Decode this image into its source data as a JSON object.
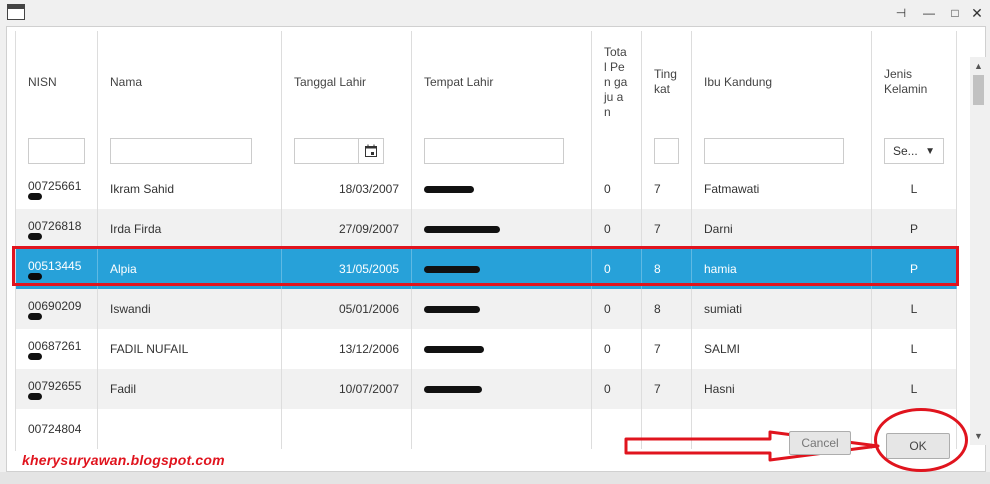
{
  "window": {
    "pin_glyph": "⊣",
    "minimize_glyph": "—",
    "maximize_glyph": "□",
    "close_glyph": "✕"
  },
  "columns": [
    {
      "key": "nisn",
      "label": "NISN"
    },
    {
      "key": "nama",
      "label": "Nama"
    },
    {
      "key": "tanggal_lahir",
      "label": "Tanggal Lahir"
    },
    {
      "key": "tempat_lahir",
      "label": "Tempat Lahir"
    },
    {
      "key": "total_pengajuan",
      "label": "Tota l Pen gaju an"
    },
    {
      "key": "tingkat",
      "label": "Ting kat"
    },
    {
      "key": "ibu_kandung",
      "label": "Ibu Kandung"
    },
    {
      "key": "jenis_kelamin",
      "label": "Jenis Kelamin"
    }
  ],
  "filters": {
    "jenis_kelamin_select": "Se...",
    "dropdown_glyph": "▼",
    "calendar_glyph": "📅"
  },
  "rows": [
    {
      "nisn": "00725661",
      "nama": "Ikram Sahid",
      "tanggal_lahir": "18/03/2007",
      "total_pengajuan": "0",
      "tingkat": "7",
      "ibu_kandung": "Fatmawati",
      "jenis_kelamin": "L",
      "selected": false
    },
    {
      "nisn": "00726818",
      "nama": "Irda Firda",
      "tanggal_lahir": "27/09/2007",
      "total_pengajuan": "0",
      "tingkat": "7",
      "ibu_kandung": "Darni",
      "jenis_kelamin": "P",
      "selected": false
    },
    {
      "nisn": "00513445",
      "nama": "Alpia",
      "tanggal_lahir": "31/05/2005",
      "total_pengajuan": "0",
      "tingkat": "8",
      "ibu_kandung": "hamia",
      "jenis_kelamin": "P",
      "selected": true
    },
    {
      "nisn": "00690209",
      "nama": "Iswandi",
      "tanggal_lahir": "05/01/2006",
      "total_pengajuan": "0",
      "tingkat": "8",
      "ibu_kandung": "sumiati",
      "jenis_kelamin": "L",
      "selected": false
    },
    {
      "nisn": "00687261",
      "nama": "FADIL NUFAIL",
      "tanggal_lahir": "13/12/2006",
      "total_pengajuan": "0",
      "tingkat": "7",
      "ibu_kandung": "SALMI",
      "jenis_kelamin": "L",
      "selected": false
    },
    {
      "nisn": "00792655",
      "nama": "Fadil",
      "tanggal_lahir": "10/07/2007",
      "total_pengajuan": "0",
      "tingkat": "7",
      "ibu_kandung": "Hasni",
      "jenis_kelamin": "L",
      "selected": false
    },
    {
      "nisn": "00724804",
      "nama": "",
      "tanggal_lahir": "",
      "total_pengajuan": "",
      "tingkat": "",
      "ibu_kandung": "",
      "jenis_kelamin": "",
      "selected": false
    }
  ],
  "buttons": {
    "cancel": "Cancel",
    "ok": "OK"
  },
  "watermark": "kherysuryawan.blogspot.com",
  "colors": {
    "selection": "#27a1d9",
    "annotation_red": "#e0141e"
  }
}
